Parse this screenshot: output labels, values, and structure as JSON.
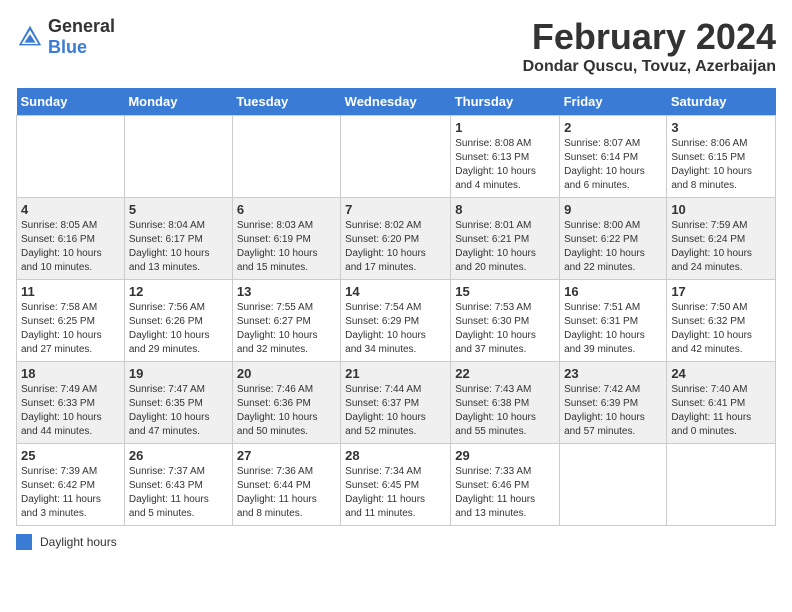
{
  "header": {
    "logo_general": "General",
    "logo_blue": "Blue",
    "month_title": "February 2024",
    "location": "Dondar Quscu, Tovuz, Azerbaijan"
  },
  "days_of_week": [
    "Sunday",
    "Monday",
    "Tuesday",
    "Wednesday",
    "Thursday",
    "Friday",
    "Saturday"
  ],
  "legend": {
    "label": "Daylight hours"
  },
  "weeks": [
    [
      {
        "day": "",
        "info": ""
      },
      {
        "day": "",
        "info": ""
      },
      {
        "day": "",
        "info": ""
      },
      {
        "day": "",
        "info": ""
      },
      {
        "day": "1",
        "info": "Sunrise: 8:08 AM\nSunset: 6:13 PM\nDaylight: 10 hours\nand 4 minutes."
      },
      {
        "day": "2",
        "info": "Sunrise: 8:07 AM\nSunset: 6:14 PM\nDaylight: 10 hours\nand 6 minutes."
      },
      {
        "day": "3",
        "info": "Sunrise: 8:06 AM\nSunset: 6:15 PM\nDaylight: 10 hours\nand 8 minutes."
      }
    ],
    [
      {
        "day": "4",
        "info": "Sunrise: 8:05 AM\nSunset: 6:16 PM\nDaylight: 10 hours\nand 10 minutes."
      },
      {
        "day": "5",
        "info": "Sunrise: 8:04 AM\nSunset: 6:17 PM\nDaylight: 10 hours\nand 13 minutes."
      },
      {
        "day": "6",
        "info": "Sunrise: 8:03 AM\nSunset: 6:19 PM\nDaylight: 10 hours\nand 15 minutes."
      },
      {
        "day": "7",
        "info": "Sunrise: 8:02 AM\nSunset: 6:20 PM\nDaylight: 10 hours\nand 17 minutes."
      },
      {
        "day": "8",
        "info": "Sunrise: 8:01 AM\nSunset: 6:21 PM\nDaylight: 10 hours\nand 20 minutes."
      },
      {
        "day": "9",
        "info": "Sunrise: 8:00 AM\nSunset: 6:22 PM\nDaylight: 10 hours\nand 22 minutes."
      },
      {
        "day": "10",
        "info": "Sunrise: 7:59 AM\nSunset: 6:24 PM\nDaylight: 10 hours\nand 24 minutes."
      }
    ],
    [
      {
        "day": "11",
        "info": "Sunrise: 7:58 AM\nSunset: 6:25 PM\nDaylight: 10 hours\nand 27 minutes."
      },
      {
        "day": "12",
        "info": "Sunrise: 7:56 AM\nSunset: 6:26 PM\nDaylight: 10 hours\nand 29 minutes."
      },
      {
        "day": "13",
        "info": "Sunrise: 7:55 AM\nSunset: 6:27 PM\nDaylight: 10 hours\nand 32 minutes."
      },
      {
        "day": "14",
        "info": "Sunrise: 7:54 AM\nSunset: 6:29 PM\nDaylight: 10 hours\nand 34 minutes."
      },
      {
        "day": "15",
        "info": "Sunrise: 7:53 AM\nSunset: 6:30 PM\nDaylight: 10 hours\nand 37 minutes."
      },
      {
        "day": "16",
        "info": "Sunrise: 7:51 AM\nSunset: 6:31 PM\nDaylight: 10 hours\nand 39 minutes."
      },
      {
        "day": "17",
        "info": "Sunrise: 7:50 AM\nSunset: 6:32 PM\nDaylight: 10 hours\nand 42 minutes."
      }
    ],
    [
      {
        "day": "18",
        "info": "Sunrise: 7:49 AM\nSunset: 6:33 PM\nDaylight: 10 hours\nand 44 minutes."
      },
      {
        "day": "19",
        "info": "Sunrise: 7:47 AM\nSunset: 6:35 PM\nDaylight: 10 hours\nand 47 minutes."
      },
      {
        "day": "20",
        "info": "Sunrise: 7:46 AM\nSunset: 6:36 PM\nDaylight: 10 hours\nand 50 minutes."
      },
      {
        "day": "21",
        "info": "Sunrise: 7:44 AM\nSunset: 6:37 PM\nDaylight: 10 hours\nand 52 minutes."
      },
      {
        "day": "22",
        "info": "Sunrise: 7:43 AM\nSunset: 6:38 PM\nDaylight: 10 hours\nand 55 minutes."
      },
      {
        "day": "23",
        "info": "Sunrise: 7:42 AM\nSunset: 6:39 PM\nDaylight: 10 hours\nand 57 minutes."
      },
      {
        "day": "24",
        "info": "Sunrise: 7:40 AM\nSunset: 6:41 PM\nDaylight: 11 hours\nand 0 minutes."
      }
    ],
    [
      {
        "day": "25",
        "info": "Sunrise: 7:39 AM\nSunset: 6:42 PM\nDaylight: 11 hours\nand 3 minutes."
      },
      {
        "day": "26",
        "info": "Sunrise: 7:37 AM\nSunset: 6:43 PM\nDaylight: 11 hours\nand 5 minutes."
      },
      {
        "day": "27",
        "info": "Sunrise: 7:36 AM\nSunset: 6:44 PM\nDaylight: 11 hours\nand 8 minutes."
      },
      {
        "day": "28",
        "info": "Sunrise: 7:34 AM\nSunset: 6:45 PM\nDaylight: 11 hours\nand 11 minutes."
      },
      {
        "day": "29",
        "info": "Sunrise: 7:33 AM\nSunset: 6:46 PM\nDaylight: 11 hours\nand 13 minutes."
      },
      {
        "day": "",
        "info": ""
      },
      {
        "day": "",
        "info": ""
      }
    ]
  ]
}
